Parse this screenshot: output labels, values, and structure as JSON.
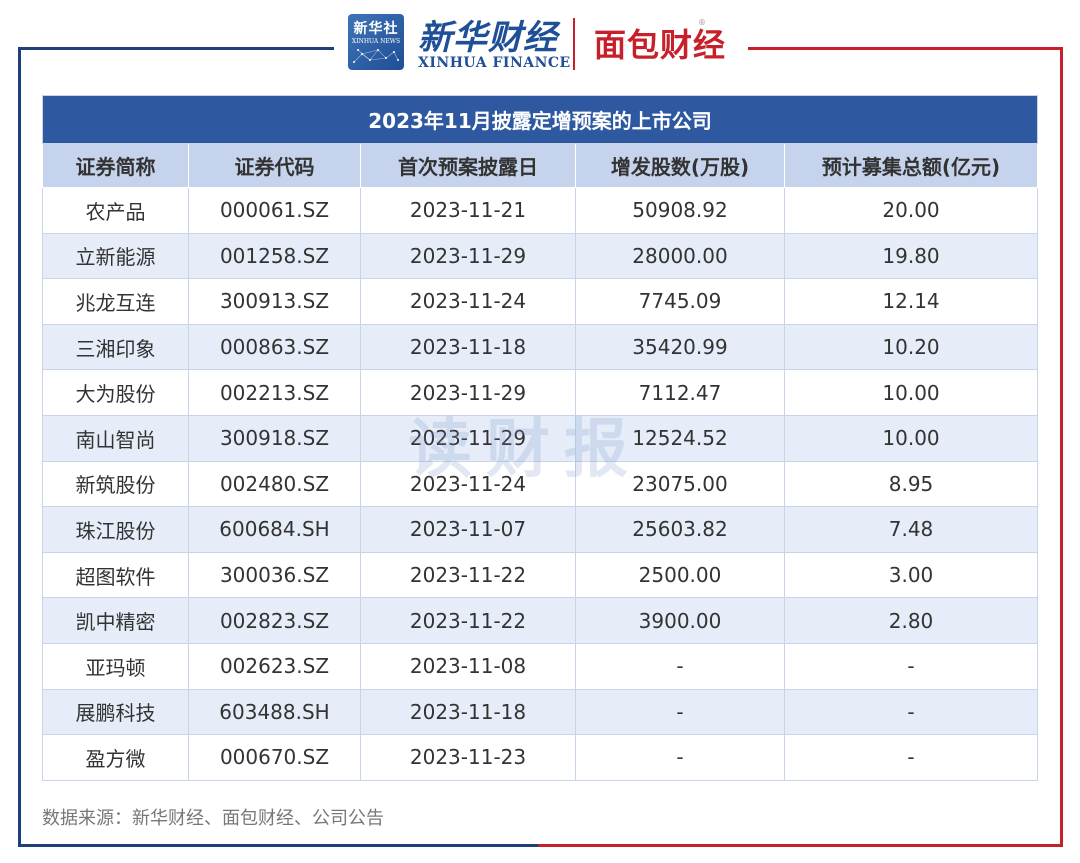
{
  "header": {
    "xinhua_box_cn": "新华社",
    "xinhua_box_en": "XINHUA NEWS",
    "xinhua_finance_cn": "新华财经",
    "xinhua_finance_en": "XINHUA FINANCE",
    "mianbao_logo": "面包财经",
    "registered_mark": "®"
  },
  "watermark": "读财报",
  "table": {
    "title": "2023年11月披露定增预案的上市公司",
    "columns": [
      "证券简称",
      "证券代码",
      "首次预案披露日",
      "增发股数(万股)",
      "预计募集总额(亿元)"
    ],
    "rows": [
      [
        "农产品",
        "000061.SZ",
        "2023-11-21",
        "50908.92",
        "20.00"
      ],
      [
        "立新能源",
        "001258.SZ",
        "2023-11-29",
        "28000.00",
        "19.80"
      ],
      [
        "兆龙互连",
        "300913.SZ",
        "2023-11-24",
        "7745.09",
        "12.14"
      ],
      [
        "三湘印象",
        "000863.SZ",
        "2023-11-18",
        "35420.99",
        "10.20"
      ],
      [
        "大为股份",
        "002213.SZ",
        "2023-11-29",
        "7112.47",
        "10.00"
      ],
      [
        "南山智尚",
        "300918.SZ",
        "2023-11-29",
        "12524.52",
        "10.00"
      ],
      [
        "新筑股份",
        "002480.SZ",
        "2023-11-24",
        "23075.00",
        "8.95"
      ],
      [
        "珠江股份",
        "600684.SH",
        "2023-11-07",
        "25603.82",
        "7.48"
      ],
      [
        "超图软件",
        "300036.SZ",
        "2023-11-22",
        "2500.00",
        "3.00"
      ],
      [
        "凯中精密",
        "002823.SZ",
        "2023-11-22",
        "3900.00",
        "2.80"
      ],
      [
        "亚玛顿",
        "002623.SZ",
        "2023-11-08",
        "-",
        "-"
      ],
      [
        "展鹏科技",
        "603488.SH",
        "2023-11-18",
        "-",
        "-"
      ],
      [
        "盈方微",
        "000670.SZ",
        "2023-11-23",
        "-",
        "-"
      ]
    ]
  },
  "source": "数据来源：新华财经、面包财经、公司公告",
  "colors": {
    "title_bg": "#2e589f",
    "header_bg": "#c5d3ec",
    "stripe_bg": "#e6ecf8",
    "frame_blue": "#1f3f7a",
    "frame_red": "#c8202a"
  }
}
